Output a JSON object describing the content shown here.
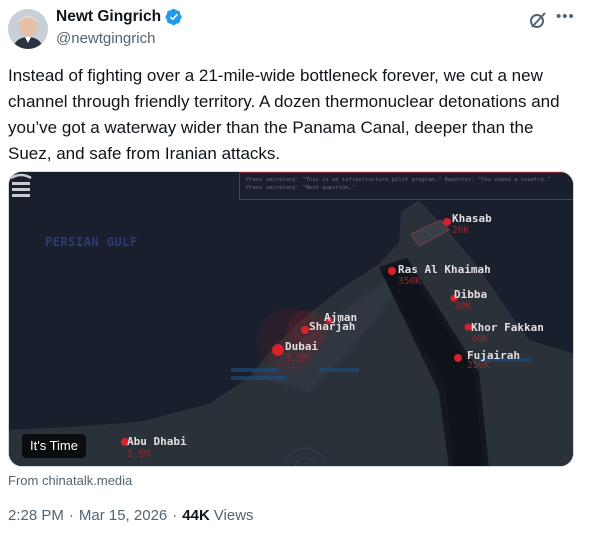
{
  "author": {
    "name": "Newt Gingrich",
    "handle": "@newtgingrich",
    "verified_color": "#1d9bf0"
  },
  "icons": {
    "grok": "grok-icon",
    "more": "more-options-icon",
    "watermark": "site-logo-icon"
  },
  "tweet": {
    "text": "Instead of fighting over a 21-mile-wide bottleneck forever, we cut a new channel through friendly territory. A dozen thermonuclear detonations and you’ve got a waterway wider than the Panama Canal, deeper than the Suez, and safe from Iranian attacks."
  },
  "media": {
    "badge": "It's Time",
    "press_note": "Press secretary: \"This is an infrastructure pilot program.\" Reporter: \"You nuked a country.\" Press secretary: \"Next question.\"",
    "sea_label": "PERSIAN GULF",
    "cities": [
      {
        "name": "Khasab",
        "pop": "20K"
      },
      {
        "name": "Ras Al Khaimah",
        "pop": "350K"
      },
      {
        "name": "Dibba",
        "pop": "30K"
      },
      {
        "name": "Ajman",
        "pop": ""
      },
      {
        "name": "Sharjah",
        "pop": ""
      },
      {
        "name": "Khor Fakkan",
        "pop": "40K"
      },
      {
        "name": "Dubai",
        "pop": "3.5M"
      },
      {
        "name": "Fujairah",
        "pop": "250K"
      },
      {
        "name": "Abu Dhabi",
        "pop": "1.5M"
      }
    ],
    "colors": {
      "sea": "#1a1f2e",
      "land": "#2a3038",
      "channel": "#171a22",
      "marker": "#d8202b"
    }
  },
  "source": "From chinatalk.media",
  "meta": {
    "time": "2:28 PM",
    "separator": "·",
    "date": "Mar 15, 2026",
    "views_count": "44K",
    "views_label": "Views"
  }
}
